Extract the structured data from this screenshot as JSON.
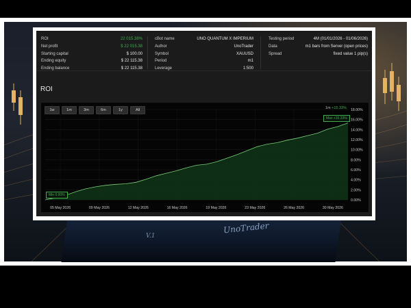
{
  "stats": {
    "left": [
      {
        "label": "ROI",
        "value": "22 015.38%",
        "color": "green"
      },
      {
        "label": "Net profit",
        "value": "$ 22 015.38",
        "color": "green"
      },
      {
        "label": "Starting capital",
        "value": "$ 100.00",
        "color": "white"
      },
      {
        "label": "Ending equity",
        "value": "$ 22 115.38",
        "color": "white"
      },
      {
        "label": "Ending balance",
        "value": "$ 22 115.38",
        "color": "white"
      }
    ],
    "middle": [
      {
        "label": "cBot name",
        "value": "UNO QUANTUM X IMPERIUM"
      },
      {
        "label": "Author",
        "value": "UnoTrader"
      },
      {
        "label": "Symbol",
        "value": "XAUUSD"
      },
      {
        "label": "Period",
        "value": "m1"
      },
      {
        "label": "Leverage",
        "value": "1:500"
      }
    ],
    "right": [
      {
        "label": "Testing period",
        "value": "4M (01/01/2026 - 01/06/2026)"
      },
      {
        "label": "Data",
        "value": "m1 bars from Server (open prices)"
      },
      {
        "label": "Spread",
        "value": "fixed value 1 pip(s)"
      }
    ]
  },
  "roi_title": "ROI",
  "range_buttons": [
    "1w",
    "1m",
    "3m",
    "6m",
    "1y",
    "All"
  ],
  "legend": {
    "period": "1m",
    "value": "+15.33%"
  },
  "max_tag": "Max +15.33%",
  "min_tag": "Min 0.00%",
  "product": {
    "brand": "UnoTrader",
    "version": "V.1"
  },
  "colors": {
    "accent_green": "#3fae4f",
    "panel_bg": "#1b1b1b",
    "chart_bg": "#050505"
  },
  "chart_data": {
    "type": "area",
    "x_ticks": [
      "05 May 2026",
      "09 May 2026",
      "12 May 2026",
      "16 May 2026",
      "19 May 2026",
      "23 May 2026",
      "26 May 2026",
      "30 May 2026"
    ],
    "y_ticks": [
      "18.00%",
      "16.00%",
      "14.00%",
      "12.00%",
      "10.00%",
      "8.00%",
      "6.00%",
      "4.00%",
      "2.00%",
      "0.00%"
    ],
    "ylim": [
      0,
      18
    ],
    "xlim": [
      0,
      30
    ],
    "series": [
      {
        "values": [
          [
            0,
            0.0
          ],
          [
            1,
            0.4
          ],
          [
            2,
            0.9
          ],
          [
            3,
            1.6
          ],
          [
            4,
            2.2
          ],
          [
            5,
            2.6
          ],
          [
            6,
            2.9
          ],
          [
            7,
            3.1
          ],
          [
            8,
            3.2
          ],
          [
            9,
            3.5
          ],
          [
            10,
            4.1
          ],
          [
            11,
            4.8
          ],
          [
            12,
            5.3
          ],
          [
            13,
            5.8
          ],
          [
            14,
            6.4
          ],
          [
            15,
            6.9
          ],
          [
            16,
            7.1
          ],
          [
            17,
            7.6
          ],
          [
            18,
            8.3
          ],
          [
            19,
            9.0
          ],
          [
            20,
            9.8
          ],
          [
            21,
            10.6
          ],
          [
            22,
            11.1
          ],
          [
            23,
            11.4
          ],
          [
            24,
            11.9
          ],
          [
            25,
            12.3
          ],
          [
            26,
            12.8
          ],
          [
            27,
            13.3
          ],
          [
            28,
            14.1
          ],
          [
            29,
            14.6
          ],
          [
            30,
            15.33
          ]
        ]
      }
    ],
    "grid": true
  }
}
